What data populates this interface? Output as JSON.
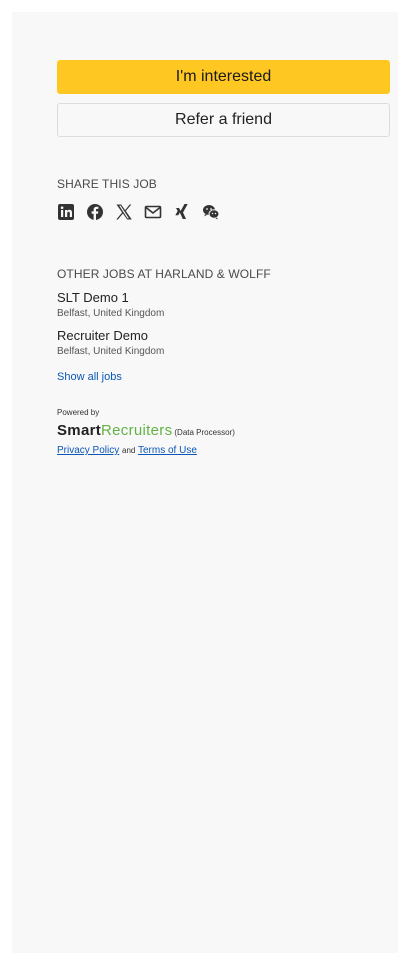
{
  "actions": {
    "interested_label": "I'm interested",
    "refer_label": "Refer a friend"
  },
  "share": {
    "title": "SHARE THIS JOB",
    "icons": [
      "linkedin-icon",
      "facebook-icon",
      "x-icon",
      "email-icon",
      "xing-icon",
      "wechat-icon"
    ]
  },
  "other_jobs": {
    "title": "OTHER JOBS AT HARLAND & WOLFF",
    "items": [
      {
        "title": "SLT Demo 1",
        "location": "Belfast, United Kingdom"
      },
      {
        "title": "Recruiter Demo",
        "location": "Belfast, United Kingdom"
      }
    ],
    "show_all": "Show all jobs"
  },
  "footer": {
    "powered_by": "Powered by",
    "brand_smart": "Smart",
    "brand_recruiters": "Recruiters",
    "brand_note": "(Data Processor)",
    "privacy": "Privacy Policy",
    "and": "and",
    "terms": "Terms of Use"
  },
  "colors": {
    "primary": "#ffc722",
    "link": "#0b57b5",
    "brand_green": "#62b246",
    "panel_bg": "#f8f8f8"
  }
}
